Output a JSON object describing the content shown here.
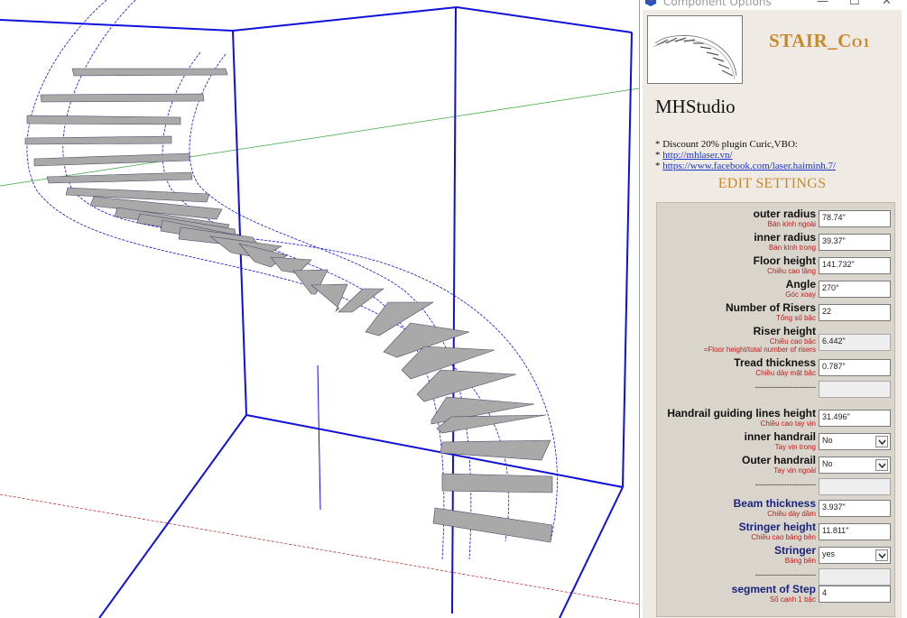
{
  "window": {
    "title": "Component Options",
    "minimize_glyph": "—",
    "maximize_glyph": "☐",
    "close_glyph": "✕"
  },
  "component": {
    "name_main": "STAIR_C",
    "name_small": "O1"
  },
  "studio_name": "MHStudio",
  "promo": {
    "discount": "* Discount 20% plugin Curic,VBO:",
    "bullet": "* ",
    "link1": "http://mhlaser.vn/",
    "link2": "https://www.facebook.com/laser.haiminh.7/"
  },
  "edit_settings_title": "EDIT SETTINGS",
  "fields": {
    "outer_radius": {
      "label": "outer radius",
      "sub": "Bán kính ngoài",
      "value": "78.74\""
    },
    "inner_radius": {
      "label": "inner radius",
      "sub": "Bán kính trong",
      "value": "39.37\""
    },
    "floor_height": {
      "label": "Floor height",
      "sub": "Chiều cao tầng",
      "value": "141.732\""
    },
    "angle": {
      "label": "Angle",
      "sub": "Góc xoay",
      "value": "270°"
    },
    "risers": {
      "label": "Number of Risers",
      "sub": "Tổng số bậc",
      "value": "22"
    },
    "riser_height": {
      "label": "Riser height",
      "sub": "Chiều cao bậc",
      "sub2": "=Floor height/total number of risers",
      "value": "6.442\""
    },
    "tread_thickness": {
      "label": "Tread thickness",
      "sub": "Chiều dày mặt bậc",
      "value": "0.787\""
    },
    "sep1": {
      "label": "-------------------------",
      "value": ""
    },
    "handrail_height": {
      "label": "Handrail guiding lines height",
      "sub": "Chiều cao tay vịn",
      "value": "31.496\""
    },
    "inner_handrail": {
      "label": "inner handrail",
      "sub": "Tay vịn trong",
      "value": "No"
    },
    "outer_handrail": {
      "label": "Outer handrail",
      "sub": "Tay vịn ngoài",
      "value": "No"
    },
    "sep2": {
      "label": "-------------------------",
      "value": ""
    },
    "beam_thickness": {
      "label": "Beam thickness",
      "sub": "Chiều dày dầm",
      "value": "3.937\""
    },
    "stringer_height": {
      "label": "Stringer height",
      "sub": "Chiều cao bảng bên",
      "value": "11.811\""
    },
    "stringer": {
      "label": "Stringer",
      "sub": "Bảng bên",
      "value": "yes"
    },
    "sep3": {
      "label": "-------------------------",
      "value": ""
    },
    "segment_step": {
      "label": "segment of Step",
      "sub": "Số cạnh 1 bậc",
      "value": "4"
    }
  },
  "colors": {
    "accent": "#c8892c",
    "label_red": "#b8221f",
    "label_blue": "#1a237e",
    "link": "#1a35c8",
    "box_edges": "#1010dd",
    "green_axis": "#3aa83a",
    "red_axis": "#c03030",
    "tread_fill": "#a9a9a9"
  }
}
